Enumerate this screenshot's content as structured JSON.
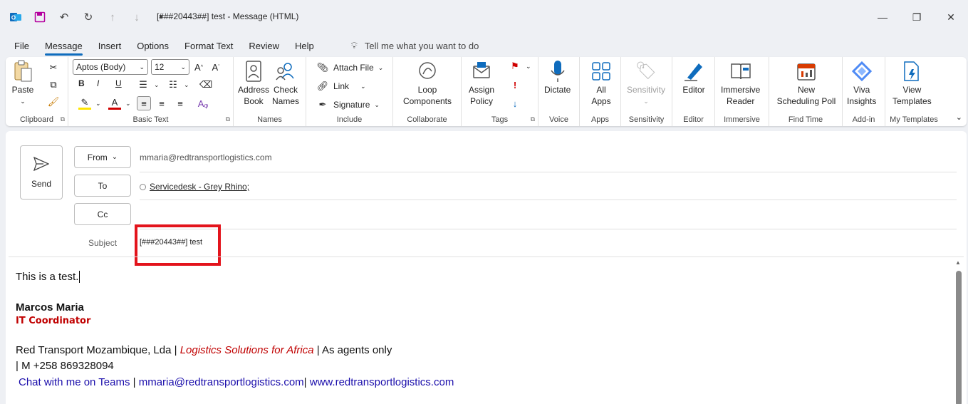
{
  "window": {
    "title": "[###20443##] test  -  Message (HTML)"
  },
  "menu": {
    "tabs": [
      "File",
      "Message",
      "Insert",
      "Options",
      "Format Text",
      "Review",
      "Help"
    ],
    "tell_me": "Tell me what you want to do"
  },
  "ribbon": {
    "clipboard": {
      "paste": "Paste",
      "label": "Clipboard"
    },
    "basic_text": {
      "font": "Aptos (Body)",
      "size": "12",
      "bold": "B",
      "italic": "I",
      "underline": "U",
      "label": "Basic Text"
    },
    "names": {
      "address_book": "Address\nBook",
      "check_names": "Check\nNames",
      "label": "Names"
    },
    "include": {
      "attach": "Attach File",
      "link": "Link",
      "signature": "Signature",
      "label": "Include"
    },
    "collaborate": {
      "loop": "Loop\nComponents",
      "label": "Collaborate"
    },
    "tags": {
      "assign_policy": "Assign\nPolicy",
      "label": "Tags"
    },
    "voice": {
      "dictate": "Dictate",
      "label": "Voice"
    },
    "apps": {
      "all_apps": "All\nApps",
      "label": "Apps"
    },
    "sensitivity": {
      "button": "Sensitivity",
      "label": "Sensitivity"
    },
    "editor": {
      "button": "Editor",
      "label": "Editor"
    },
    "immersive": {
      "button": "Immersive\nReader",
      "label": "Immersive"
    },
    "find_time": {
      "button": "New\nScheduling Poll",
      "label": "Find Time"
    },
    "addin": {
      "button": "Viva\nInsights",
      "label": "Add-in"
    },
    "templates": {
      "button": "View\nTemplates",
      "label": "My Templates"
    }
  },
  "compose": {
    "send": "Send",
    "from_label": "From",
    "from_value": "mmaria@redtransportlogistics.com",
    "to_label": "To",
    "to_value": "Servicedesk - Grey Rhino;",
    "cc_label": "Cc",
    "subject_label": "Subject",
    "subject_value": "[###20443##] test"
  },
  "body": {
    "line1": "This is a test.",
    "sig_name": "Marcos Maria",
    "sig_title": "IT Coordinator",
    "company_a": "Red Transport Mozambique, Lda | ",
    "company_tagline": "Logistics Solutions for Africa",
    "company_b": " | As agents only",
    "phone": "| M +258 869328094",
    "teams_link": "Chat with me on Teams",
    "sep1": " | ",
    "email_link": "mmaria@redtransportlogistics.com",
    "sep2": "| ",
    "web_link": "www.redtransportlogistics.com"
  },
  "colors": {
    "accent": "#0f6cbd",
    "highlight": "#e3141c",
    "sig_title": "#c00000"
  }
}
